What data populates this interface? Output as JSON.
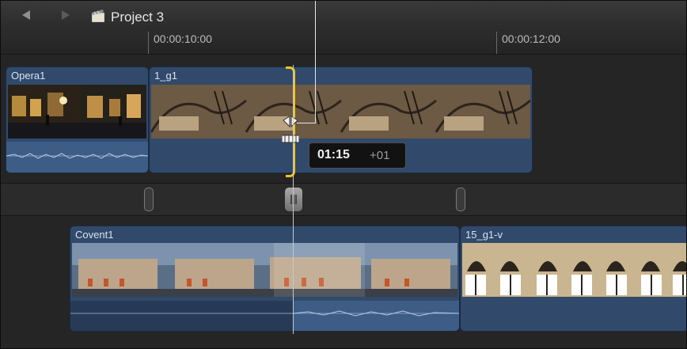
{
  "window": {
    "project_title": "Project 3"
  },
  "toolbar": {
    "back_icon": "triangle-left-icon",
    "forward_icon": "triangle-right-icon",
    "project_icon": "clapperboard-icon"
  },
  "ruler": {
    "timecodes": [
      "00:00:10:00",
      "00:00:12:00"
    ]
  },
  "clips": {
    "opera": {
      "title": "Opera1"
    },
    "g1": {
      "title": "1_g1"
    },
    "covent": {
      "title": "Covent1"
    },
    "g15": {
      "title": "15_g1-v"
    }
  },
  "trim_tooltip": {
    "timecode": "01:15",
    "delta": "+01"
  },
  "colors": {
    "clip_blue": "#314a6b",
    "audio_blue": "#3e5d86",
    "trim_yellow": "#f0c419",
    "background": "#1f1f1f"
  }
}
